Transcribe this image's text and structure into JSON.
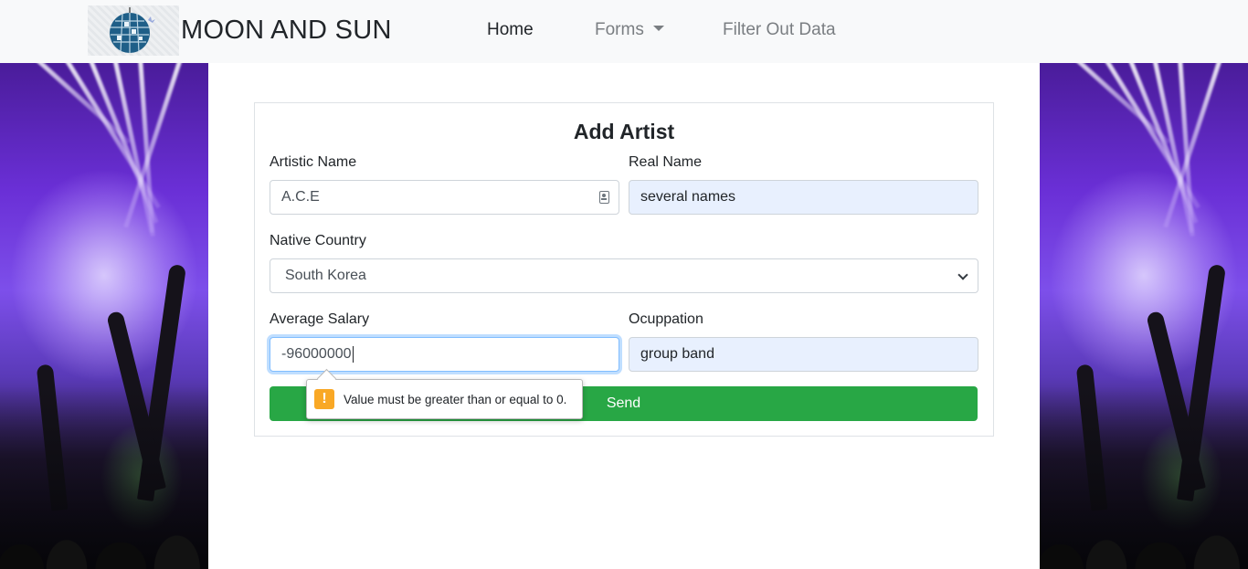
{
  "nav": {
    "brand": "MOON AND SUN",
    "links": [
      {
        "label": "Home"
      },
      {
        "label": "Forms"
      },
      {
        "label": "Filter Out Data"
      }
    ]
  },
  "form": {
    "title": "Add Artist",
    "artistic_name": {
      "label": "Artistic Name",
      "value": "A.C.E"
    },
    "real_name": {
      "label": "Real Name",
      "value": "several names"
    },
    "native_country": {
      "label": "Native Country",
      "value": "South Korea"
    },
    "average_salary": {
      "label": "Average Salary",
      "value": "-96000000"
    },
    "occupation": {
      "label": "Ocuppation",
      "value": "group band"
    },
    "submit_label": "Send"
  },
  "validation": {
    "icon": "warning-icon",
    "message": "Value must be greater than or equal to 0."
  },
  "colors": {
    "navbar_bg": "#f8f9fa",
    "send_button": "#28a745",
    "autofill_bg": "#e8f0fe",
    "focus_border": "#80bdff",
    "warning": "#f9a825"
  }
}
